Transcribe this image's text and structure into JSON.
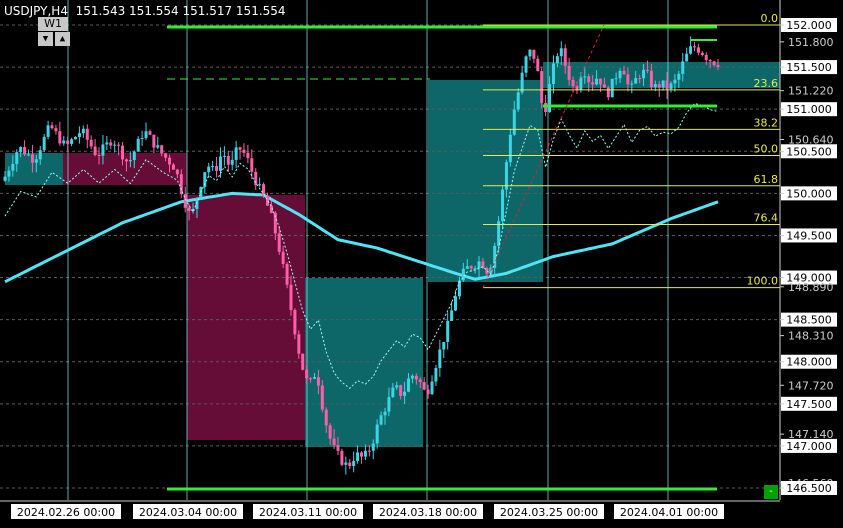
{
  "header": {
    "symbol": "USDJPY,H4",
    "ohlc": "151.543 151.554 151.517 151.554",
    "timeframe_button": "W1",
    "scroll_down": "▼",
    "scroll_up": "▲"
  },
  "colors": {
    "background": "#000000",
    "bull": "#3bd6e6",
    "bear": "#ff5fa8",
    "demand_zone": "#0e6b6e",
    "supply_zone": "#6b0e3a",
    "fib": "#e8e84a",
    "level_green": "#33ee33",
    "ma": "#4ee6f7",
    "grid_v": "#7fe0e6"
  },
  "price_axis": [
    {
      "label": "152.000",
      "price": 152.0,
      "box": true
    },
    {
      "label": "151.800",
      "price": 151.8,
      "box": false
    },
    {
      "label": "151.500",
      "price": 151.5,
      "box": true
    },
    {
      "label": "151.220",
      "price": 151.22,
      "box": false
    },
    {
      "label": "151.000",
      "price": 151.0,
      "box": true
    },
    {
      "label": "150.640",
      "price": 150.64,
      "box": false
    },
    {
      "label": "150.500",
      "price": 150.5,
      "box": true
    },
    {
      "label": "150.000",
      "price": 150.0,
      "box": true
    },
    {
      "label": "149.500",
      "price": 149.5,
      "box": true
    },
    {
      "label": "149.000",
      "price": 149.0,
      "box": true
    },
    {
      "label": "148.890",
      "price": 148.89,
      "box": false
    },
    {
      "label": "148.500",
      "price": 148.5,
      "box": true
    },
    {
      "label": "148.310",
      "price": 148.31,
      "box": false
    },
    {
      "label": "148.000",
      "price": 148.0,
      "box": true
    },
    {
      "label": "147.720",
      "price": 147.72,
      "box": false
    },
    {
      "label": "147.500",
      "price": 147.5,
      "box": true
    },
    {
      "label": "147.140",
      "price": 147.14,
      "box": false
    },
    {
      "label": "147.000",
      "price": 147.0,
      "box": true
    },
    {
      "label": "146.560",
      "price": 146.56,
      "box": false
    },
    {
      "label": "146.500",
      "price": 146.5,
      "box": true
    }
  ],
  "fib_levels": [
    {
      "label": "0.0",
      "price": 152.0
    },
    {
      "label": "23.6",
      "price": 151.23
    },
    {
      "label": "38.2",
      "price": 150.76
    },
    {
      "label": "50.0",
      "price": 150.45
    },
    {
      "label": "61.8",
      "price": 150.09
    },
    {
      "label": "76.4",
      "price": 149.63
    },
    {
      "label": "100.0",
      "price": 148.88
    }
  ],
  "time_axis": [
    {
      "label": "2024.02.26 00:00"
    },
    {
      "label": "2024.03.04 00:00"
    },
    {
      "label": "2024.03.11 00:00"
    },
    {
      "label": "2024.03.18 00:00"
    },
    {
      "label": "2024.03.25 00:00"
    },
    {
      "label": "2024.04.01 00:00"
    }
  ],
  "chart_data": {
    "type": "candlestick",
    "symbol": "USDJPY",
    "timeframe": "H4",
    "ylim": [
      146.45,
      152.1
    ],
    "anchor_points": [
      [
        0,
        150.15
      ],
      [
        4,
        150.55
      ],
      [
        8,
        150.4
      ],
      [
        12,
        150.8
      ],
      [
        16,
        150.55
      ],
      [
        20,
        150.75
      ],
      [
        24,
        150.45
      ],
      [
        28,
        150.65
      ],
      [
        32,
        150.35
      ],
      [
        36,
        150.75
      ],
      [
        40,
        150.5
      ],
      [
        44,
        150.3
      ],
      [
        46,
        149.95
      ],
      [
        48,
        149.7
      ],
      [
        50,
        150.05
      ],
      [
        52,
        150.35
      ],
      [
        54,
        150.25
      ],
      [
        56,
        150.5
      ],
      [
        58,
        150.3
      ],
      [
        60,
        150.55
      ],
      [
        62,
        150.45
      ],
      [
        64,
        150.2
      ],
      [
        66,
        150.0
      ],
      [
        68,
        149.8
      ],
      [
        70,
        149.45
      ],
      [
        72,
        149.0
      ],
      [
        74,
        148.5
      ],
      [
        76,
        148.0
      ],
      [
        78,
        147.7
      ],
      [
        80,
        147.9
      ],
      [
        82,
        147.35
      ],
      [
        84,
        147.0
      ],
      [
        86,
        146.85
      ],
      [
        88,
        146.75
      ],
      [
        90,
        146.9
      ],
      [
        92,
        146.85
      ],
      [
        94,
        147.0
      ],
      [
        96,
        147.3
      ],
      [
        98,
        147.5
      ],
      [
        100,
        147.7
      ],
      [
        102,
        147.6
      ],
      [
        104,
        147.85
      ],
      [
        106,
        147.8
      ],
      [
        108,
        147.6
      ],
      [
        110,
        147.9
      ],
      [
        112,
        148.2
      ],
      [
        114,
        148.5
      ],
      [
        116,
        148.9
      ],
      [
        118,
        149.1
      ],
      [
        120,
        149.15
      ],
      [
        122,
        149.2
      ],
      [
        124,
        149.05
      ],
      [
        126,
        149.5
      ],
      [
        128,
        150.2
      ],
      [
        130,
        150.9
      ],
      [
        132,
        151.3
      ],
      [
        134,
        151.7
      ],
      [
        136,
        151.6
      ],
      [
        138,
        150.9
      ],
      [
        140,
        151.4
      ],
      [
        142,
        151.75
      ],
      [
        144,
        151.45
      ],
      [
        146,
        151.2
      ],
      [
        148,
        151.5
      ],
      [
        150,
        151.3
      ],
      [
        152,
        151.4
      ],
      [
        154,
        151.15
      ],
      [
        156,
        151.35
      ],
      [
        158,
        151.55
      ],
      [
        160,
        151.2
      ],
      [
        162,
        151.4
      ],
      [
        164,
        151.45
      ],
      [
        166,
        151.25
      ],
      [
        168,
        151.3
      ],
      [
        170,
        151.25
      ],
      [
        172,
        151.35
      ],
      [
        174,
        151.6
      ],
      [
        176,
        151.75
      ],
      [
        178,
        151.7
      ],
      [
        180,
        151.6
      ],
      [
        182,
        151.55
      ]
    ],
    "ma_points": [
      [
        0,
        148.95
      ],
      [
        15,
        149.3
      ],
      [
        30,
        149.65
      ],
      [
        45,
        149.9
      ],
      [
        58,
        150.0
      ],
      [
        66,
        149.98
      ],
      [
        75,
        149.75
      ],
      [
        85,
        149.45
      ],
      [
        95,
        149.35
      ],
      [
        105,
        149.2
      ],
      [
        115,
        149.05
      ],
      [
        120,
        148.98
      ],
      [
        128,
        149.05
      ],
      [
        140,
        149.25
      ],
      [
        155,
        149.4
      ],
      [
        170,
        149.7
      ],
      [
        182,
        149.9
      ]
    ]
  }
}
